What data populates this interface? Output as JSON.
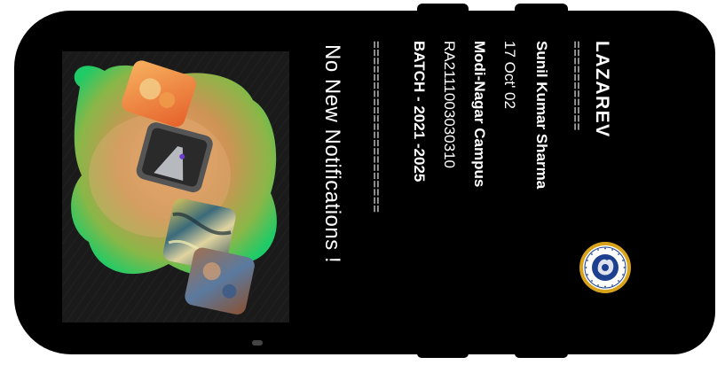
{
  "card": {
    "brand": "LAZAREV",
    "separator_short": "===========",
    "name": "Sunil Kumar Sharma",
    "dob": "17 Oct' 02",
    "campus": "Modi-Nagar Campus",
    "register_number": "RA2111003030310",
    "batch": "BATCH - 2021 -2025",
    "separator_long": "=====================",
    "notification": "No New Notifications !"
  },
  "logo": {
    "icon": "university-seal-icon"
  },
  "artwork": {
    "icon": "abstract-3d-blob-icon"
  },
  "colors": {
    "background": "#000000",
    "text": "#ffffff",
    "seal_ring": "#d9a21b",
    "seal_inner": "#1c3f8f"
  }
}
